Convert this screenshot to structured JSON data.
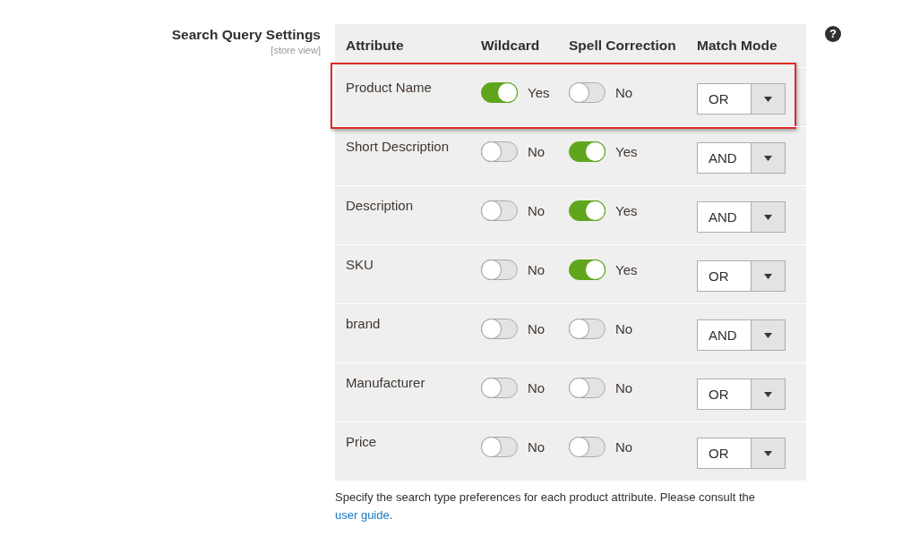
{
  "section": {
    "title": "Search Query Settings",
    "scope": "[store view]"
  },
  "table": {
    "columns": [
      "Attribute",
      "Wildcard",
      "Spell Correction",
      "Match Mode"
    ],
    "rows": [
      {
        "attribute": "Product Name",
        "highlighted": true,
        "wildcard": {
          "on": true,
          "label": "Yes"
        },
        "spell_correction": {
          "on": false,
          "label": "No"
        },
        "match_mode": "OR"
      },
      {
        "attribute": "Short Description",
        "highlighted": false,
        "wildcard": {
          "on": false,
          "label": "No"
        },
        "spell_correction": {
          "on": true,
          "label": "Yes"
        },
        "match_mode": "AND"
      },
      {
        "attribute": "Description",
        "highlighted": false,
        "wildcard": {
          "on": false,
          "label": "No"
        },
        "spell_correction": {
          "on": true,
          "label": "Yes"
        },
        "match_mode": "AND"
      },
      {
        "attribute": "SKU",
        "highlighted": false,
        "wildcard": {
          "on": false,
          "label": "No"
        },
        "spell_correction": {
          "on": true,
          "label": "Yes"
        },
        "match_mode": "OR"
      },
      {
        "attribute": "brand",
        "highlighted": false,
        "wildcard": {
          "on": false,
          "label": "No"
        },
        "spell_correction": {
          "on": false,
          "label": "No"
        },
        "match_mode": "AND"
      },
      {
        "attribute": "Manufacturer",
        "highlighted": false,
        "wildcard": {
          "on": false,
          "label": "No"
        },
        "spell_correction": {
          "on": false,
          "label": "No"
        },
        "match_mode": "OR"
      },
      {
        "attribute": "Price",
        "highlighted": false,
        "wildcard": {
          "on": false,
          "label": "No"
        },
        "spell_correction": {
          "on": false,
          "label": "No"
        },
        "match_mode": "OR"
      }
    ]
  },
  "help": "?",
  "note": {
    "text": "Specify the search type preferences for each product attribute. Please consult the",
    "link": "user guide",
    "end": "."
  }
}
